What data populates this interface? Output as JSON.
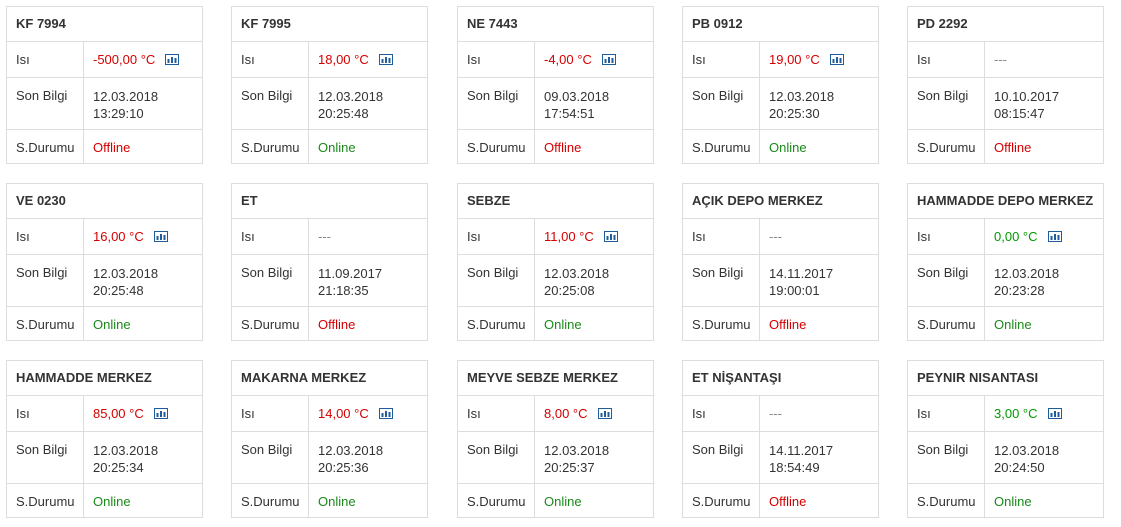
{
  "labels": {
    "isi": "Isı",
    "son_bilgi": "Son Bilgi",
    "durum": "S.Durumu"
  },
  "colors": {
    "red": "#d40000",
    "green": "#009900",
    "border": "#dddddd",
    "chart_icon": "#1f5d9c"
  },
  "icons": {
    "chart": "bar-chart-icon"
  },
  "cards": [
    {
      "title": "KF 7994",
      "temp": "-500,00 °C",
      "temp_color": "red",
      "date": "12.03.2018",
      "time": "13:29:10",
      "status": "Offline"
    },
    {
      "title": "KF 7995",
      "temp": "18,00 °C",
      "temp_color": "red",
      "date": "12.03.2018",
      "time": "20:25:48",
      "status": "Online"
    },
    {
      "title": "NE 7443",
      "temp": "-4,00 °C",
      "temp_color": "red",
      "date": "09.03.2018",
      "time": "17:54:51",
      "status": "Offline"
    },
    {
      "title": "PB 0912",
      "temp": "19,00 °C",
      "temp_color": "red",
      "date": "12.03.2018",
      "time": "20:25:30",
      "status": "Online"
    },
    {
      "title": "PD 2292",
      "temp": "---",
      "temp_color": "none",
      "date": "10.10.2017",
      "time": "08:15:47",
      "status": "Offline"
    },
    {
      "title": "VE 0230",
      "temp": "16,00 °C",
      "temp_color": "red",
      "date": "12.03.2018",
      "time": "20:25:48",
      "status": "Online"
    },
    {
      "title": "ET",
      "temp": "---",
      "temp_color": "none",
      "date": "11.09.2017",
      "time": "21:18:35",
      "status": "Offline"
    },
    {
      "title": "SEBZE",
      "temp": "11,00 °C",
      "temp_color": "red",
      "date": "12.03.2018",
      "time": "20:25:08",
      "status": "Online"
    },
    {
      "title": "AÇIK DEPO MERKEZ",
      "temp": "---",
      "temp_color": "none",
      "date": "14.11.2017",
      "time": "19:00:01",
      "status": "Offline"
    },
    {
      "title": "HAMMADDE DEPO MERKEZ",
      "temp": "0,00 °C",
      "temp_color": "green",
      "date": "12.03.2018",
      "time": "20:23:28",
      "status": "Online"
    },
    {
      "title": "HAMMADDE MERKEZ",
      "temp": "85,00 °C",
      "temp_color": "red",
      "date": "12.03.2018",
      "time": "20:25:34",
      "status": "Online"
    },
    {
      "title": "MAKARNA MERKEZ",
      "temp": "14,00 °C",
      "temp_color": "red",
      "date": "12.03.2018",
      "time": "20:25:36",
      "status": "Online"
    },
    {
      "title": "MEYVE SEBZE MERKEZ",
      "temp": "8,00 °C",
      "temp_color": "red",
      "date": "12.03.2018",
      "time": "20:25:37",
      "status": "Online"
    },
    {
      "title": "ET NİŞANTAŞI",
      "temp": "---",
      "temp_color": "none",
      "date": "14.11.2017",
      "time": "18:54:49",
      "status": "Offline"
    },
    {
      "title": "PEYNIR NISANTASI",
      "temp": "3,00 °C",
      "temp_color": "green",
      "date": "12.03.2018",
      "time": "20:24:50",
      "status": "Online"
    }
  ]
}
